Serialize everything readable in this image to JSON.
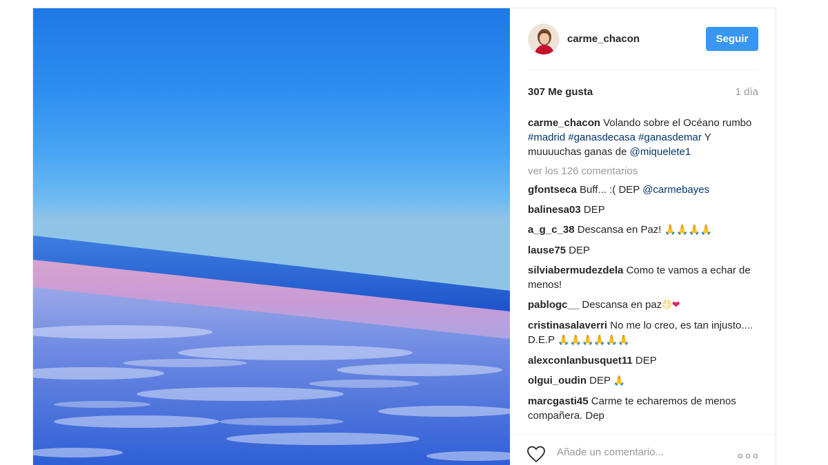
{
  "post": {
    "author": "carme_chacon",
    "follow_label": "Seguir",
    "likes": "307 Me gusta",
    "time_ago": "1 día",
    "caption": {
      "user": "carme_chacon",
      "text_1": " Volando sobre el Océano rumbo ",
      "tag_1": "#madrid",
      "tag_2": "#ganasdecasa",
      "tag_3": "#ganasdemar",
      "text_2": " Y muuuuchas ganas de ",
      "mention": "@miquelete1"
    },
    "view_all_comments": "ver los 126 comentarios",
    "comments": [
      {
        "user": "gfontseca",
        "text": "Buff... :( DEP ",
        "mention": "@carmebayes"
      },
      {
        "user": "balinesa03",
        "text": "DEP"
      },
      {
        "user": "a_g_c_38",
        "text": "Descansa en Paz! ",
        "emoji": "🙏🙏🙏🙏"
      },
      {
        "user": "lause75",
        "text": "DEP"
      },
      {
        "user": "silviabermudezdela",
        "text": "Como te vamos a echar de menos!"
      },
      {
        "user": "pablogc__",
        "text": "Descansa en paz",
        "emoji": "😓",
        "emoji_2": "❤"
      },
      {
        "user": "cristinasalaverri",
        "text": "No me lo creo, es tan injusto.... D.E.P ",
        "emoji": "🙏🙏🙏🙏🙏🙏"
      },
      {
        "user": "alexconlanbusquet11",
        "text": "DEP"
      },
      {
        "user": "olgui_oudin",
        "text": "DEP ",
        "emoji": "🙏"
      },
      {
        "user": "marcgasti45",
        "text": "Carme te echaremos de menos compañera. Dep"
      }
    ],
    "add_comment_placeholder": "Añade un comentario..."
  },
  "colors": {
    "follow_button": "#3897f0",
    "hashtag": "#003569",
    "muted_text": "#999999"
  },
  "icons": [
    "heart-icon",
    "more-options-icon",
    "avatar"
  ]
}
